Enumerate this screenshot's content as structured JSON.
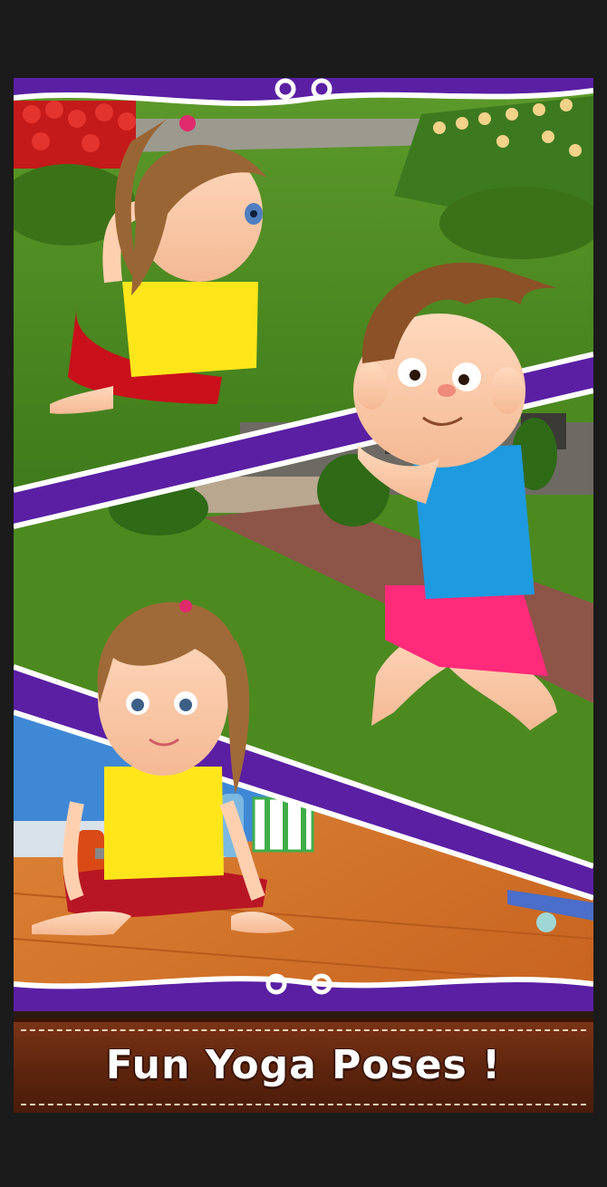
{
  "banner": {
    "caption": "Fun Yoga Poses !"
  },
  "scenes": [
    {
      "name": "garden-twist-pose",
      "character": "girl",
      "setting": "flower garden lawn"
    },
    {
      "name": "lunge-prayer-pose",
      "character": "boy",
      "setting": "house yard path"
    },
    {
      "name": "seated-pose",
      "character": "girl",
      "setting": "indoor wooden floor"
    }
  ],
  "colors": {
    "purple_band": "#5a1fa3",
    "grass": "#4f8f22",
    "floor": "#d9782f",
    "banner_brown": "#5d240d",
    "caption": "#ffffff"
  }
}
